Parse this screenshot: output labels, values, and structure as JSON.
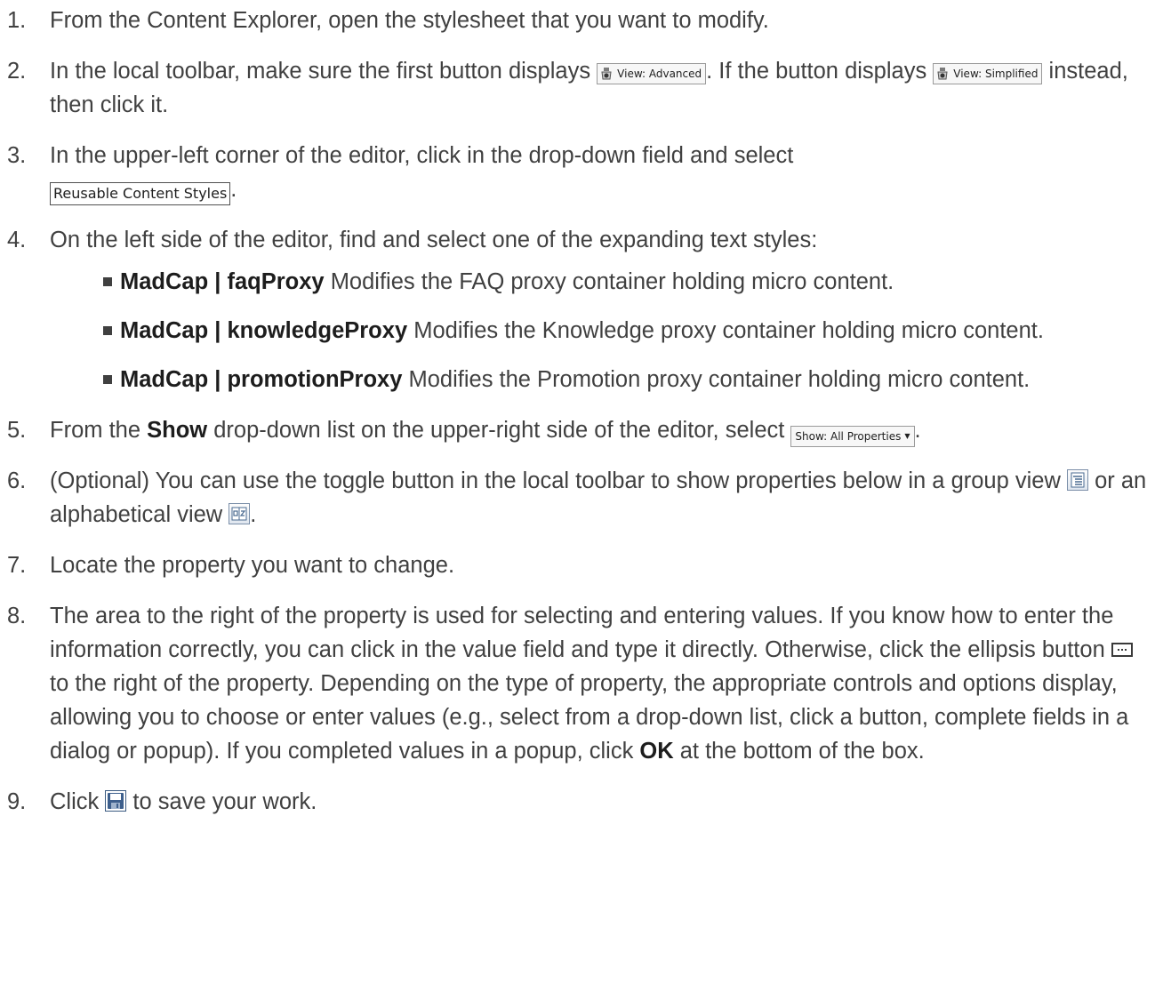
{
  "steps": [
    {
      "num": "1.",
      "text": "From the Content Explorer, open the stylesheet that you want to modify."
    },
    {
      "num": "2.",
      "before": "In the local toolbar, make sure the first button displays ",
      "button_advanced": "View: Advanced",
      "middle": ". If the button displays ",
      "button_simplified": "View: Simplified",
      "after": " instead, then click it."
    },
    {
      "num": "3.",
      "text": "In the upper-left corner of the editor, click in the drop-down field and select ",
      "field": "Reusable Content Styles",
      "after": "."
    },
    {
      "num": "4.",
      "text": "On the left side of the editor, find and select one of the expanding text styles:",
      "sub": [
        {
          "bold": "MadCap | faqProxy",
          "text": " Modifies the FAQ proxy container holding micro content."
        },
        {
          "bold": "MadCap | knowledgeProxy",
          "text": " Modifies the Knowledge proxy container holding micro content."
        },
        {
          "bold": "MadCap | promotionProxy",
          "text": " Modifies the Promotion proxy container holding micro content."
        }
      ]
    },
    {
      "num": "5.",
      "before": "From the ",
      "bold": "Show",
      "middle": " drop-down list on the upper-right side of the editor, select ",
      "button": "Show: All Properties",
      "after": "."
    },
    {
      "num": "6.",
      "before": "(Optional) You can use the toggle button in the local toolbar to show properties below in a group view ",
      "middle": " or an alphabetical view ",
      "after": "."
    },
    {
      "num": "7.",
      "text": "Locate the property you want to change."
    },
    {
      "num": "8.",
      "before": "The area to the right of the property is used for selecting and entering values. If you know how to enter the information correctly, you can click in the value field and type it directly. Otherwise, click the ellipsis button ",
      "middle": " to the right of the property. Depending on the type of property, the appropriate controls and options display, allowing you to choose or enter values (e.g., select from a drop-down list, click a button, complete fields in a dialog or popup). If you completed values in a popup, click ",
      "bold": "OK",
      "after": " at the bottom of the box."
    },
    {
      "num": "9.",
      "before": "Click ",
      "after": " to save your work."
    }
  ],
  "icons": {
    "view": "eye-dropper-icon",
    "group_view": "group-view-icon",
    "alphabetical_view": "alphabetical-view-icon",
    "ellipsis": "ellipsis-button-icon",
    "save": "save-icon"
  },
  "colors": {
    "text": "#404040",
    "bold_text": "#1d1d1d",
    "background": "#ffffff"
  }
}
